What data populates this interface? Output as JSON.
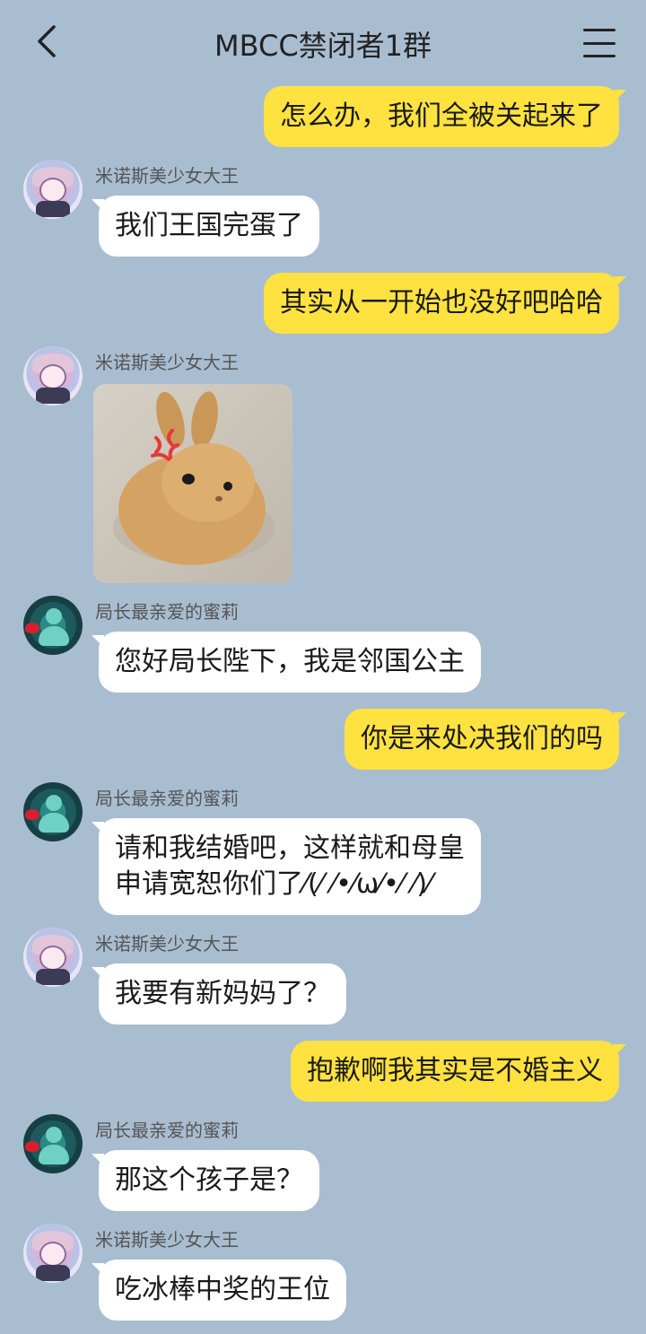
{
  "header": {
    "title": "MBCC禁闭者1群",
    "back_icon": "chevron-left-icon",
    "menu_icon": "hamburger-menu-icon"
  },
  "colors": {
    "background": "#a9bdd1",
    "outgoing_bubble": "#ffe23f",
    "incoming_bubble": "#ffffff"
  },
  "messages": [
    {
      "direction": "out",
      "text": "怎么办，我们全被关起来了"
    },
    {
      "direction": "in",
      "sender": "米诺斯美少女大王",
      "text": "我们王国完蛋了"
    },
    {
      "direction": "out",
      "text": "其实从一开始也没好吧哈哈"
    },
    {
      "direction": "in",
      "sender": "米诺斯美少女大王",
      "sticker": "angry-bunny-sticker"
    },
    {
      "direction": "in",
      "sender": "局长最亲爱的蜜莉",
      "text": "您好局长陛下，我是邻国公主"
    },
    {
      "direction": "out",
      "text": "你是来处决我们的吗"
    },
    {
      "direction": "in",
      "sender": "局长最亲爱的蜜莉",
      "text_line1": "请和我结婚吧，这样就和母皇",
      "text_line2": "申请宽恕你们了⁄(⁄ ⁄•⁄ω⁄•⁄ ⁄)⁄"
    },
    {
      "direction": "in",
      "sender": "米诺斯美少女大王",
      "text": "我要有新妈妈了？"
    },
    {
      "direction": "out",
      "text": "抱歉啊我其实是不婚主义"
    },
    {
      "direction": "in",
      "sender": "局长最亲爱的蜜莉",
      "text": "那这个孩子是？"
    },
    {
      "direction": "in",
      "sender": "米诺斯美少女大王",
      "text": "吃冰棒中奖的王位"
    }
  ]
}
